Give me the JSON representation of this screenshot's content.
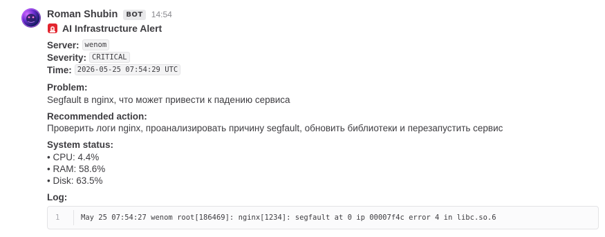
{
  "post": {
    "username": "Roman Shubin",
    "bot_badge": "BOT",
    "time": "14:54",
    "title": "AI Infrastructure Alert",
    "title_icon": "rotating-light-icon",
    "server_label": "Server:",
    "server_value": "wenom",
    "severity_label": "Severity:",
    "severity_value": "CRITICAL",
    "time_label": "Time:",
    "time_value": "2026-05-25 07:54:29 UTC",
    "problem_label": "Problem:",
    "problem_text": "Segfault в nginx, что может привести к падению сервиса",
    "action_label": "Recommended action:",
    "action_text": "Проверить логи nginx, проанализировать причину segfault, обновить библиотеки и перезапустить сервис",
    "status_label": "System status:",
    "status_items": [
      "• CPU: 4.4%",
      "• RAM: 58.6%",
      "• Disk: 63.5%"
    ],
    "log_label": "Log:",
    "log": {
      "line_number": "1",
      "text": "May 25 07:54:27 wenom root[186469]: nginx[1234]: segfault at 0 ip 00007f4c error 4 in libc.so.6"
    }
  }
}
